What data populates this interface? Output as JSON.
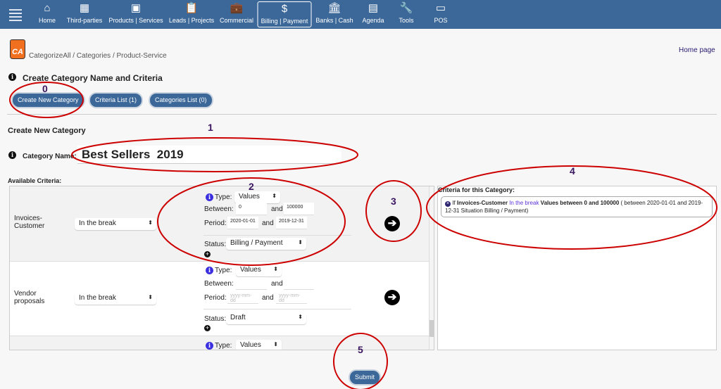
{
  "nav": {
    "items": [
      {
        "label": "Home",
        "icon": "⌂"
      },
      {
        "label": "Third-parties",
        "icon": "▦"
      },
      {
        "label": "Products | Services",
        "icon": "▣"
      },
      {
        "label": "Leads | Projects",
        "icon": "📋"
      },
      {
        "label": "Commercial",
        "icon": "💼"
      },
      {
        "label": "Billing | Payment",
        "icon": "$"
      },
      {
        "label": "Banks | Cash",
        "icon": "🏛"
      },
      {
        "label": "Agenda",
        "icon": "▤"
      },
      {
        "label": "Tools",
        "icon": "🔧"
      },
      {
        "label": "POS",
        "icon": "▭"
      }
    ],
    "active": "Billing | Payment"
  },
  "logo": "CA",
  "breadcrumb": "CategorizeAll / Categories / Product-Service",
  "home_link": "Home page",
  "section_title": "Create Category Name and Criteria",
  "buttons": {
    "create": "Create New Category",
    "criteria_list": "Criteria List (1)",
    "categories_list": "Categories List (0)",
    "submit": "Submit"
  },
  "form_title": "Create New Category",
  "category_name_label": "Category Name:",
  "category_name_value": "Best Sellers  2019",
  "available_label": "Available Criteria:",
  "labels": {
    "type": "Type:",
    "between": "Between:",
    "and": "and",
    "period": "Period:",
    "status": "Status:"
  },
  "criteria": [
    {
      "name": "Invoices-Customer",
      "mode": "In the break",
      "type": "Values",
      "min": "0",
      "max": "100000",
      "from": "2020-01-01",
      "to": "2019-12-31",
      "status": "Billing / Payment"
    },
    {
      "name": "Vendor proposals",
      "mode": "In the break",
      "type": "Values",
      "min": "",
      "max": "",
      "from_ph": "yyyy-mm-dd",
      "to_ph": "yyyy-mm-dd",
      "status": "Draft"
    },
    {
      "type": "Values"
    }
  ],
  "selected_title": "Criteria for this Category:",
  "selected": {
    "if": "If",
    "name": "Invoices-Customer",
    "mode": "In the break",
    "cond": "Values between 0 and 100000",
    "rest": "( between 2020-01-01 and 2019-12-31 Situation Billing / Payment)"
  },
  "annotations": [
    "0",
    "1",
    "2",
    "3",
    "4",
    "5"
  ]
}
